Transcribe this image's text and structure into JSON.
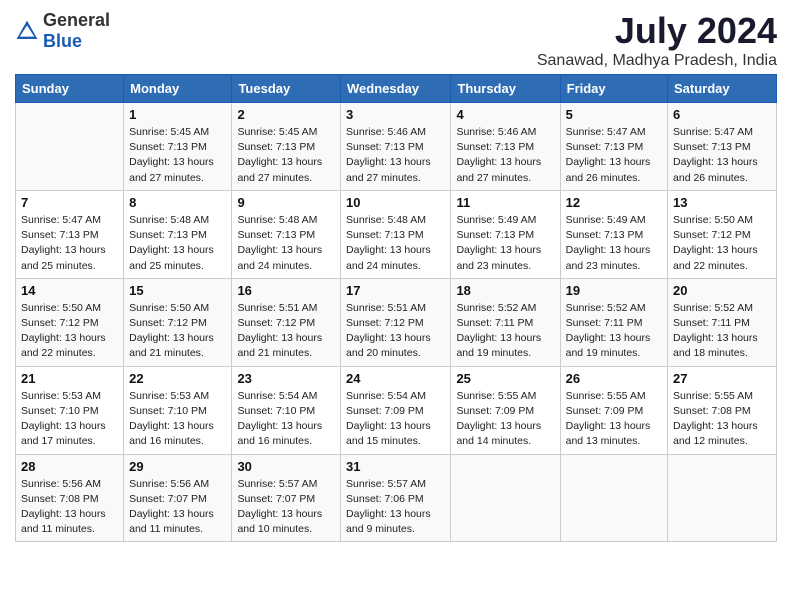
{
  "logo": {
    "general": "General",
    "blue": "Blue"
  },
  "title": "July 2024",
  "subtitle": "Sanawad, Madhya Pradesh, India",
  "columns": [
    "Sunday",
    "Monday",
    "Tuesday",
    "Wednesday",
    "Thursday",
    "Friday",
    "Saturday"
  ],
  "weeks": [
    [
      {
        "day": "",
        "info": ""
      },
      {
        "day": "1",
        "info": "Sunrise: 5:45 AM\nSunset: 7:13 PM\nDaylight: 13 hours\nand 27 minutes."
      },
      {
        "day": "2",
        "info": "Sunrise: 5:45 AM\nSunset: 7:13 PM\nDaylight: 13 hours\nand 27 minutes."
      },
      {
        "day": "3",
        "info": "Sunrise: 5:46 AM\nSunset: 7:13 PM\nDaylight: 13 hours\nand 27 minutes."
      },
      {
        "day": "4",
        "info": "Sunrise: 5:46 AM\nSunset: 7:13 PM\nDaylight: 13 hours\nand 27 minutes."
      },
      {
        "day": "5",
        "info": "Sunrise: 5:47 AM\nSunset: 7:13 PM\nDaylight: 13 hours\nand 26 minutes."
      },
      {
        "day": "6",
        "info": "Sunrise: 5:47 AM\nSunset: 7:13 PM\nDaylight: 13 hours\nand 26 minutes."
      }
    ],
    [
      {
        "day": "7",
        "info": "Sunrise: 5:47 AM\nSunset: 7:13 PM\nDaylight: 13 hours\nand 25 minutes."
      },
      {
        "day": "8",
        "info": "Sunrise: 5:48 AM\nSunset: 7:13 PM\nDaylight: 13 hours\nand 25 minutes."
      },
      {
        "day": "9",
        "info": "Sunrise: 5:48 AM\nSunset: 7:13 PM\nDaylight: 13 hours\nand 24 minutes."
      },
      {
        "day": "10",
        "info": "Sunrise: 5:48 AM\nSunset: 7:13 PM\nDaylight: 13 hours\nand 24 minutes."
      },
      {
        "day": "11",
        "info": "Sunrise: 5:49 AM\nSunset: 7:13 PM\nDaylight: 13 hours\nand 23 minutes."
      },
      {
        "day": "12",
        "info": "Sunrise: 5:49 AM\nSunset: 7:13 PM\nDaylight: 13 hours\nand 23 minutes."
      },
      {
        "day": "13",
        "info": "Sunrise: 5:50 AM\nSunset: 7:12 PM\nDaylight: 13 hours\nand 22 minutes."
      }
    ],
    [
      {
        "day": "14",
        "info": "Sunrise: 5:50 AM\nSunset: 7:12 PM\nDaylight: 13 hours\nand 22 minutes."
      },
      {
        "day": "15",
        "info": "Sunrise: 5:50 AM\nSunset: 7:12 PM\nDaylight: 13 hours\nand 21 minutes."
      },
      {
        "day": "16",
        "info": "Sunrise: 5:51 AM\nSunset: 7:12 PM\nDaylight: 13 hours\nand 21 minutes."
      },
      {
        "day": "17",
        "info": "Sunrise: 5:51 AM\nSunset: 7:12 PM\nDaylight: 13 hours\nand 20 minutes."
      },
      {
        "day": "18",
        "info": "Sunrise: 5:52 AM\nSunset: 7:11 PM\nDaylight: 13 hours\nand 19 minutes."
      },
      {
        "day": "19",
        "info": "Sunrise: 5:52 AM\nSunset: 7:11 PM\nDaylight: 13 hours\nand 19 minutes."
      },
      {
        "day": "20",
        "info": "Sunrise: 5:52 AM\nSunset: 7:11 PM\nDaylight: 13 hours\nand 18 minutes."
      }
    ],
    [
      {
        "day": "21",
        "info": "Sunrise: 5:53 AM\nSunset: 7:10 PM\nDaylight: 13 hours\nand 17 minutes."
      },
      {
        "day": "22",
        "info": "Sunrise: 5:53 AM\nSunset: 7:10 PM\nDaylight: 13 hours\nand 16 minutes."
      },
      {
        "day": "23",
        "info": "Sunrise: 5:54 AM\nSunset: 7:10 PM\nDaylight: 13 hours\nand 16 minutes."
      },
      {
        "day": "24",
        "info": "Sunrise: 5:54 AM\nSunset: 7:09 PM\nDaylight: 13 hours\nand 15 minutes."
      },
      {
        "day": "25",
        "info": "Sunrise: 5:55 AM\nSunset: 7:09 PM\nDaylight: 13 hours\nand 14 minutes."
      },
      {
        "day": "26",
        "info": "Sunrise: 5:55 AM\nSunset: 7:09 PM\nDaylight: 13 hours\nand 13 minutes."
      },
      {
        "day": "27",
        "info": "Sunrise: 5:55 AM\nSunset: 7:08 PM\nDaylight: 13 hours\nand 12 minutes."
      }
    ],
    [
      {
        "day": "28",
        "info": "Sunrise: 5:56 AM\nSunset: 7:08 PM\nDaylight: 13 hours\nand 11 minutes."
      },
      {
        "day": "29",
        "info": "Sunrise: 5:56 AM\nSunset: 7:07 PM\nDaylight: 13 hours\nand 11 minutes."
      },
      {
        "day": "30",
        "info": "Sunrise: 5:57 AM\nSunset: 7:07 PM\nDaylight: 13 hours\nand 10 minutes."
      },
      {
        "day": "31",
        "info": "Sunrise: 5:57 AM\nSunset: 7:06 PM\nDaylight: 13 hours\nand 9 minutes."
      },
      {
        "day": "",
        "info": ""
      },
      {
        "day": "",
        "info": ""
      },
      {
        "day": "",
        "info": ""
      }
    ]
  ]
}
